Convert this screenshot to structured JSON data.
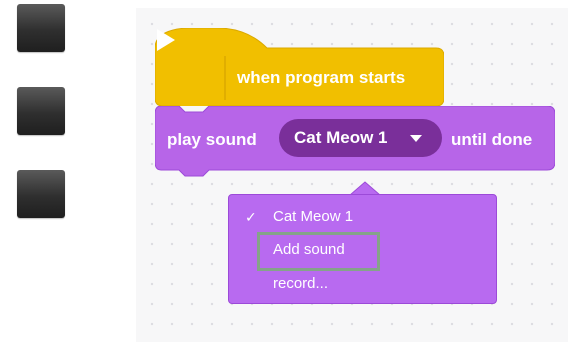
{
  "palette": {
    "items": [
      "",
      "",
      ""
    ]
  },
  "hat_block": {
    "label": "when program starts",
    "color": "#f1bf00"
  },
  "sound_block": {
    "prefix": "play sound",
    "selected": "Cat Meow 1",
    "suffix": "until done",
    "color": "#b765e8",
    "pill_color": "#7a2f9a"
  },
  "dropdown": {
    "items": [
      {
        "label": "Cat Meow 1",
        "checked": true
      },
      {
        "label": "Add sound",
        "checked": false,
        "highlighted": true
      },
      {
        "label": "record...",
        "checked": false
      }
    ],
    "check_glyph": "✓"
  },
  "icons": {
    "play": "play-triangle-icon",
    "caret": "caret-down-icon"
  }
}
